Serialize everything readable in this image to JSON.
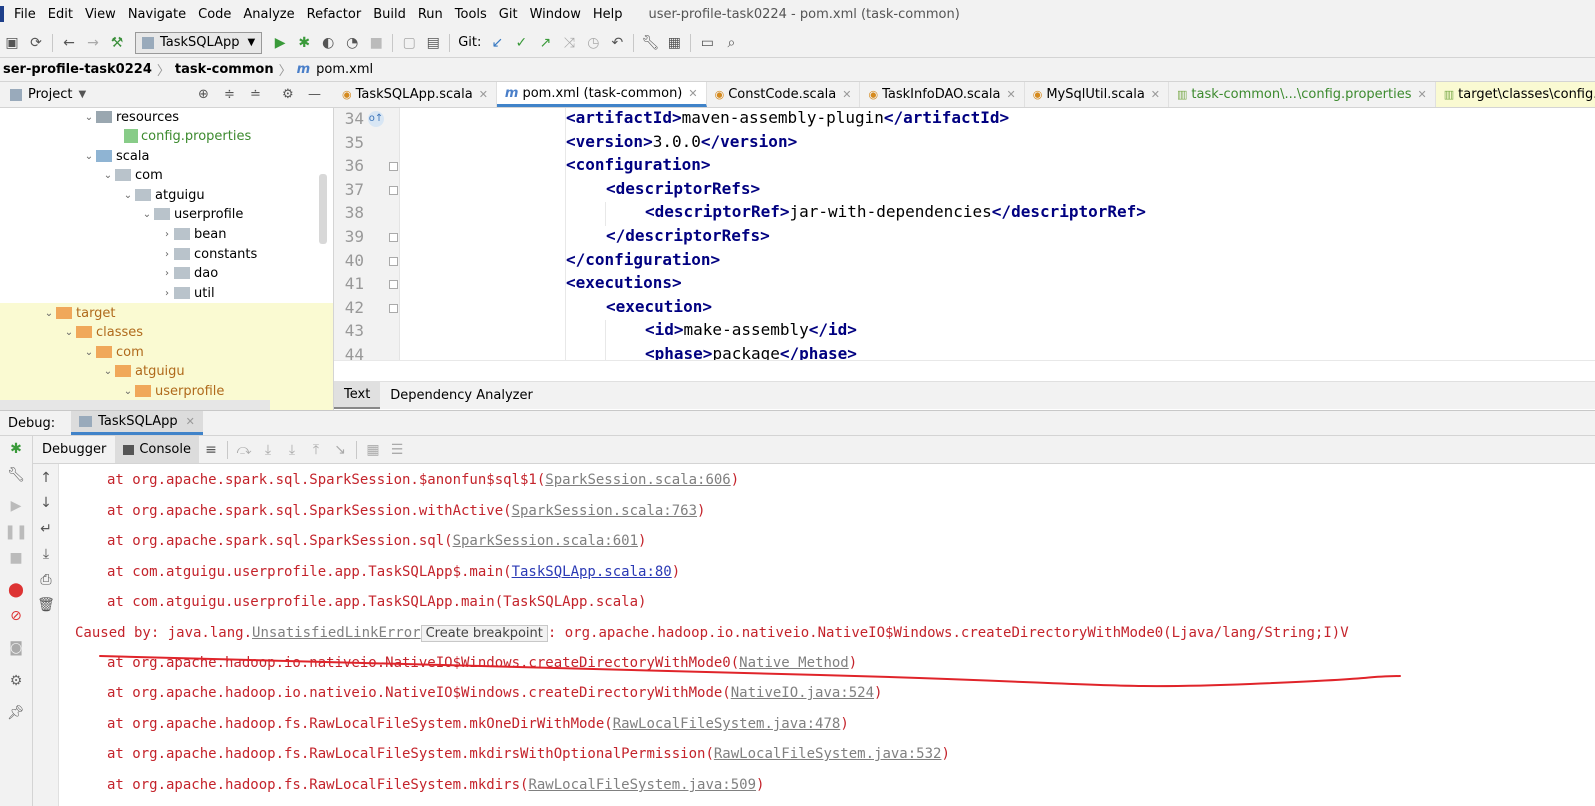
{
  "menu": {
    "items": [
      "File",
      "Edit",
      "View",
      "Navigate",
      "Code",
      "Analyze",
      "Refactor",
      "Build",
      "Run",
      "Tools",
      "Git",
      "Window",
      "Help"
    ],
    "window_title": "user-profile-task0224 - pom.xml (task-common)"
  },
  "toolbar": {
    "run_config": "TaskSQLApp",
    "git_label": "Git:"
  },
  "breadcrumb": {
    "items": [
      "ser-profile-task0224",
      "task-common",
      "pom.xml"
    ]
  },
  "project_panel": {
    "title": "Project",
    "tree": [
      {
        "label": "resources",
        "icon": "folder-icon"
      },
      {
        "label": "config.properties",
        "icon": "properties-file-icon"
      },
      {
        "label": "scala",
        "icon": "folder-icon"
      },
      {
        "label": "com",
        "icon": "package-icon"
      },
      {
        "label": "atguigu",
        "icon": "package-icon"
      },
      {
        "label": "userprofile",
        "icon": "package-icon"
      },
      {
        "label": "bean",
        "icon": "package-icon"
      },
      {
        "label": "constants",
        "icon": "package-icon"
      },
      {
        "label": "dao",
        "icon": "package-icon"
      },
      {
        "label": "util",
        "icon": "package-icon"
      },
      {
        "label": "target",
        "icon": "folder-icon"
      },
      {
        "label": "classes",
        "icon": "folder-icon"
      },
      {
        "label": "com",
        "icon": "folder-icon"
      },
      {
        "label": "atguigu",
        "icon": "folder-icon"
      },
      {
        "label": "userprofile",
        "icon": "folder-icon"
      }
    ]
  },
  "editor_tabs": [
    {
      "label": "TaskSQLApp.scala"
    },
    {
      "label": "pom.xml (task-common)"
    },
    {
      "label": "ConstCode.scala"
    },
    {
      "label": "TaskInfoDAO.scala"
    },
    {
      "label": "MySqlUtil.scala"
    },
    {
      "label": "task-common\\...\\config.properties"
    },
    {
      "label": "target\\classes\\config.properties"
    }
  ],
  "code": {
    "line_numbers": [
      "34",
      "35",
      "36",
      "37",
      "38",
      "39",
      "40",
      "41",
      "42",
      "43",
      "44"
    ],
    "lines": [
      {
        "open": "<artifactId>",
        "text": "maven-assembly-plugin",
        "close": "</artifactId>"
      },
      {
        "open": "<version>",
        "text": "3.0.0",
        "close": "</version>"
      },
      {
        "open": "<configuration>",
        "text": "",
        "close": ""
      },
      {
        "open": "<descriptorRefs>",
        "text": "",
        "close": ""
      },
      {
        "open": "<descriptorRef>",
        "text": "jar-with-dependencies",
        "close": "</descriptorRef>"
      },
      {
        "open": "</descriptorRefs>",
        "text": "",
        "close": ""
      },
      {
        "open": "</configuration>",
        "text": "",
        "close": ""
      },
      {
        "open": "<executions>",
        "text": "",
        "close": ""
      },
      {
        "open": "<execution>",
        "text": "",
        "close": ""
      },
      {
        "open": "<id>",
        "text": "make-assembly",
        "close": "</id>"
      },
      {
        "open": "<phase>",
        "text": "package",
        "close": "</phase>"
      }
    ]
  },
  "editor_bottom_tabs": [
    "Text",
    "Dependency Analyzer"
  ],
  "debug": {
    "label": "Debug:",
    "session": "TaskSQLApp",
    "tabs": [
      "Debugger",
      "Console"
    ]
  },
  "console": {
    "lines": [
      {
        "prefix": "at org.apache.spark.sql.SparkSession.$anonfun$sql$1(",
        "link": "SparkSession.scala:606",
        "suffix": ")"
      },
      {
        "prefix": "at org.apache.spark.sql.SparkSession.withActive(",
        "link": "SparkSession.scala:763",
        "suffix": ")"
      },
      {
        "prefix": "at org.apache.spark.sql.SparkSession.sql(",
        "link": "SparkSession.scala:601",
        "suffix": ")"
      },
      {
        "prefix": "at com.atguigu.userprofile.app.TaskSQLApp$.main(",
        "link": "TaskSQLApp.scala:80",
        "suffix": ")"
      },
      {
        "prefix": "at com.atguigu.userprofile.app.TaskSQLApp.main(TaskSQLApp.scala)",
        "link": "",
        "suffix": ""
      },
      {
        "prefix": "Caused by: java.lang.",
        "link": "UnsatisfiedLinkError",
        "tooltip": "Create breakpoint",
        "suffix": ": org.apache.hadoop.io.nativeio.NativeIO$Windows.createDirectoryWithMode0(Ljava/lang/String;I)V"
      },
      {
        "prefix": "at org.apache.hadoop.io.nativeio.NativeIO$Windows.createDirectoryWithMode0(",
        "link": "Native Method",
        "suffix": ")"
      },
      {
        "prefix": "at org.apache.hadoop.io.nativeio.NativeIO$Windows.createDirectoryWithMode(",
        "link": "NativeIO.java:524",
        "suffix": ")"
      },
      {
        "prefix": "at org.apache.hadoop.fs.RawLocalFileSystem.mkOneDirWithMode(",
        "link": "RawLocalFileSystem.java:478",
        "suffix": ")"
      },
      {
        "prefix": "at org.apache.hadoop.fs.RawLocalFileSystem.mkdirsWithOptionalPermission(",
        "link": "RawLocalFileSystem.java:532",
        "suffix": ")"
      },
      {
        "prefix": "at org.apache.hadoop.fs.RawLocalFileSystem.mkdirs(",
        "link": "RawLocalFileSystem.java:509",
        "suffix": ")"
      }
    ]
  },
  "colors": {
    "error_text": "#c4232b",
    "link_gray": "#808080",
    "link_blue": "#2b3ab5",
    "xml_tag": "#000080",
    "annotation_stroke": "#e0242a",
    "highlight_yellow": "#fafad2"
  }
}
